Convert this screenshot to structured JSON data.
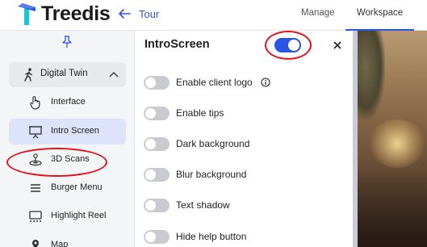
{
  "header": {
    "brand": "Treedis",
    "back_label": "Tour",
    "nav": {
      "manage": "Manage",
      "workspace": "Workspace"
    },
    "accent_color": "#2a55e6"
  },
  "sidebar": {
    "group": {
      "label": "Digital Twin",
      "icon": "person-walking-icon",
      "expanded": true
    },
    "items": [
      {
        "label": "Interface",
        "icon": "pointer-hand-icon",
        "active": false
      },
      {
        "label": "Intro Screen",
        "icon": "presentation-screen-icon",
        "active": true
      },
      {
        "label": "3D Scans",
        "icon": "scan-icon",
        "active": false
      },
      {
        "label": "Burger Menu",
        "icon": "hamburger-menu-icon",
        "active": false
      },
      {
        "label": "Highlight Reel",
        "icon": "highlight-reel-icon",
        "active": false
      },
      {
        "label": "Map",
        "icon": "map-icon",
        "active": false
      }
    ]
  },
  "panel": {
    "title": "IntroScreen",
    "enabled": true,
    "options": [
      {
        "label": "Enable client logo",
        "on": false,
        "info": true
      },
      {
        "label": "Enable tips",
        "on": false
      },
      {
        "label": "Dark background",
        "on": false
      },
      {
        "label": "Blur background",
        "on": false
      },
      {
        "label": "Text shadow",
        "on": false
      },
      {
        "label": "Hide help button",
        "on": false
      }
    ]
  },
  "annotations": {
    "highlight_color": "#e0121e"
  }
}
